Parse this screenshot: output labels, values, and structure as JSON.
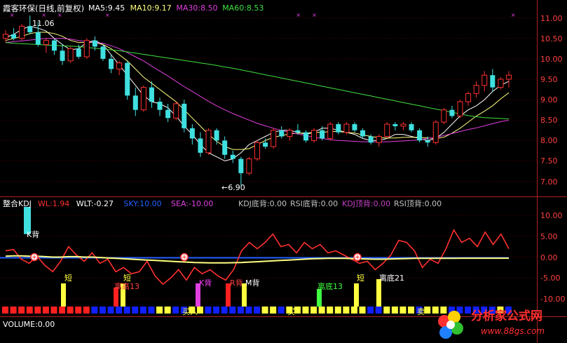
{
  "main": {
    "title": "霞客环保(日线,前复权)",
    "ma": [
      {
        "label": "MA5:9.45",
        "color": "#ffffff"
      },
      {
        "label": "MA10:9.17",
        "color": "#ffff80"
      },
      {
        "label": "MA30:8.50",
        "color": "#e040e0"
      },
      {
        "label": "MA60:8.53",
        "color": "#40e040"
      }
    ],
    "high_label": "11.06",
    "low_label": "←6.90",
    "y_ticks": [
      "11.00",
      "10.50",
      "10.00",
      "9.50",
      "9.00",
      "8.50",
      "8.00",
      "7.50",
      "7.00"
    ]
  },
  "kdj": {
    "title": "整合KDJ",
    "params": [
      {
        "label": "WL:1.94",
        "color": "#ff3030"
      },
      {
        "label": "WLT:-0.27",
        "color": "#ffffff"
      },
      {
        "label": "SKY:10.00",
        "color": "#2060ff"
      },
      {
        "label": "SEA:-10.00",
        "color": "#e040e0"
      },
      {
        "label": "KDJ底背:0.00",
        "color": "#c0c0c0"
      },
      {
        "label": "RSI底背:0.00",
        "color": "#c0c0c0"
      },
      {
        "label": "KDJ顶背:0.00",
        "color": "#c040c0"
      },
      {
        "label": "RSI顶背:0.00",
        "color": "#c0c0c0"
      }
    ],
    "y_ticks": [
      "10.00",
      "5.00",
      "0.00",
      "-5.00",
      "-10.00"
    ],
    "annotations": [
      {
        "text": "K背",
        "color": "#ffffff"
      },
      {
        "text": "短",
        "color": "#ffff40"
      },
      {
        "text": "离高13",
        "color": "#ff4040"
      },
      {
        "text": "短",
        "color": "#ffff40"
      },
      {
        "text": "K背",
        "color": "#ff40ff"
      },
      {
        "text": "R背",
        "color": "#ff4040"
      },
      {
        "text": "M背",
        "color": "#ffffff"
      },
      {
        "text": "离底13",
        "color": "#40ff40"
      },
      {
        "text": "短",
        "color": "#ffff40"
      },
      {
        "text": "离底21",
        "color": "#ffffff"
      },
      {
        "text": "买入",
        "color": "#ffff40"
      },
      {
        "text": "买",
        "color": "#ffff40"
      },
      {
        "text": "卖",
        "color": "#ffff40"
      }
    ]
  },
  "volume": {
    "label": "VOLUME:0.00"
  },
  "watermark": {
    "line1": "分析家公式网",
    "line2": "www.88gs.com"
  },
  "chart_data": [
    {
      "type": "candlestick",
      "title": "霞客环保(日线,前复权)",
      "ylim": [
        6.7,
        11.2
      ],
      "series": [
        {
          "name": "MA5",
          "values": [
            10.52,
            10.6,
            10.72,
            10.8,
            10.75,
            10.68,
            10.5,
            10.35,
            10.22,
            10.25,
            10.4,
            10.45,
            10.35,
            10.1,
            9.85,
            9.6,
            9.35,
            9.1,
            8.95,
            8.9,
            8.8,
            8.6,
            8.35,
            8.15,
            7.9,
            7.7,
            7.6,
            7.5,
            7.55,
            7.7,
            7.9,
            8.0,
            8.1,
            8.2,
            8.25,
            8.25,
            8.2,
            8.15,
            8.2,
            8.3,
            8.3,
            8.25,
            8.2,
            8.15,
            8.05,
            8.0,
            8.0,
            8.05,
            8.15,
            8.15,
            8.1,
            8.05,
            8.0,
            8.05,
            8.2,
            8.4,
            8.6,
            8.75,
            8.85,
            9.0,
            9.2,
            9.35,
            9.45
          ]
        },
        {
          "name": "MA10",
          "values": [
            10.45,
            10.5,
            10.55,
            10.62,
            10.65,
            10.65,
            10.62,
            10.55,
            10.45,
            10.4,
            10.4,
            10.4,
            10.35,
            10.25,
            10.1,
            9.95,
            9.75,
            9.55,
            9.4,
            9.25,
            9.1,
            8.95,
            8.75,
            8.55,
            8.35,
            8.15,
            7.98,
            7.85,
            7.78,
            7.78,
            7.8,
            7.9,
            8.0,
            8.08,
            8.12,
            8.16,
            8.18,
            8.18,
            8.2,
            8.2,
            8.22,
            8.22,
            8.2,
            8.18,
            8.14,
            8.1,
            8.07,
            8.06,
            8.06,
            8.08,
            8.08,
            8.08,
            8.06,
            8.05,
            8.08,
            8.18,
            8.3,
            8.45,
            8.6,
            8.72,
            8.85,
            9.02,
            9.17
          ]
        },
        {
          "name": "MA30",
          "values": [
            10.4,
            10.42,
            10.44,
            10.46,
            10.48,
            10.5,
            10.5,
            10.5,
            10.48,
            10.45,
            10.42,
            10.4,
            10.38,
            10.32,
            10.25,
            10.15,
            10.05,
            9.95,
            9.82,
            9.7,
            9.58,
            9.45,
            9.32,
            9.2,
            9.08,
            8.96,
            8.85,
            8.75,
            8.66,
            8.58,
            8.5,
            8.42,
            8.36,
            8.3,
            8.25,
            8.2,
            8.16,
            8.12,
            8.08,
            8.05,
            8.02,
            8.0,
            7.99,
            7.98,
            7.97,
            7.97,
            7.97,
            7.97,
            7.98,
            7.99,
            8.0,
            8.02,
            8.05,
            8.08,
            8.12,
            8.17,
            8.22,
            8.27,
            8.31,
            8.36,
            8.41,
            8.46,
            8.5
          ]
        },
        {
          "name": "MA60",
          "values": [
            10.4,
            10.38,
            10.37,
            10.36,
            10.35,
            10.34,
            10.33,
            10.32,
            10.31,
            10.3,
            10.28,
            10.26,
            10.24,
            10.22,
            10.2,
            10.17,
            10.14,
            10.11,
            10.08,
            10.05,
            10.02,
            9.99,
            9.96,
            9.93,
            9.9,
            9.87,
            9.84,
            9.8,
            9.77,
            9.73,
            9.69,
            9.65,
            9.61,
            9.57,
            9.53,
            9.49,
            9.45,
            9.41,
            9.37,
            9.33,
            9.29,
            9.25,
            9.21,
            9.17,
            9.13,
            9.09,
            9.05,
            9.01,
            8.97,
            8.93,
            8.89,
            8.85,
            8.81,
            8.77,
            8.73,
            8.69,
            8.65,
            8.61,
            8.58,
            8.56,
            8.55,
            8.54,
            8.53
          ]
        }
      ],
      "candles": [
        [
          10.5,
          10.7,
          10.4,
          10.6
        ],
        [
          10.6,
          10.75,
          10.45,
          10.5
        ],
        [
          10.5,
          10.85,
          10.45,
          10.8
        ],
        [
          10.8,
          11.06,
          10.6,
          10.65
        ],
        [
          10.65,
          10.9,
          10.3,
          10.35
        ],
        [
          10.35,
          10.5,
          10.15,
          10.45
        ],
        [
          10.45,
          10.5,
          10.1,
          10.2
        ],
        [
          10.2,
          10.35,
          9.85,
          9.95
        ],
        [
          9.95,
          10.3,
          9.9,
          10.25
        ],
        [
          10.25,
          10.35,
          10.0,
          10.05
        ],
        [
          10.05,
          10.5,
          10.0,
          10.45
        ],
        [
          10.45,
          10.55,
          10.2,
          10.3
        ],
        [
          10.3,
          10.35,
          9.95,
          10.0
        ],
        [
          10.0,
          10.1,
          9.65,
          9.75
        ],
        [
          9.75,
          9.95,
          9.6,
          9.9
        ],
        [
          9.9,
          9.95,
          9.0,
          9.1
        ],
        [
          9.1,
          9.3,
          8.6,
          8.75
        ],
        [
          8.75,
          9.35,
          8.7,
          9.3
        ],
        [
          9.3,
          9.45,
          8.8,
          8.95
        ],
        [
          8.95,
          9.05,
          8.6,
          8.75
        ],
        [
          8.75,
          8.9,
          8.45,
          8.55
        ],
        [
          8.55,
          8.95,
          8.5,
          8.9
        ],
        [
          8.9,
          9.0,
          8.2,
          8.3
        ],
        [
          8.3,
          8.4,
          7.9,
          8.05
        ],
        [
          8.05,
          8.2,
          7.6,
          7.7
        ],
        [
          7.7,
          8.3,
          7.65,
          8.25
        ],
        [
          8.25,
          8.3,
          7.9,
          8.0
        ],
        [
          8.0,
          8.1,
          7.55,
          7.65
        ],
        [
          7.65,
          7.75,
          7.45,
          7.55
        ],
        [
          7.55,
          7.6,
          6.9,
          7.2
        ],
        [
          7.2,
          7.6,
          7.15,
          7.55
        ],
        [
          7.55,
          8.0,
          7.5,
          7.95
        ],
        [
          7.95,
          8.05,
          7.8,
          7.85
        ],
        [
          7.85,
          8.3,
          7.8,
          8.25
        ],
        [
          8.25,
          8.35,
          8.05,
          8.1
        ],
        [
          8.1,
          8.3,
          8.0,
          8.25
        ],
        [
          8.25,
          8.4,
          8.15,
          8.2
        ],
        [
          8.2,
          8.25,
          7.95,
          8.0
        ],
        [
          8.0,
          8.3,
          7.95,
          8.25
        ],
        [
          8.25,
          8.35,
          8.0,
          8.05
        ],
        [
          8.05,
          8.45,
          8.0,
          8.4
        ],
        [
          8.4,
          8.45,
          8.15,
          8.2
        ],
        [
          8.2,
          8.45,
          8.15,
          8.4
        ],
        [
          8.4,
          8.45,
          8.2,
          8.25
        ],
        [
          8.25,
          8.3,
          8.05,
          8.1
        ],
        [
          8.1,
          8.15,
          7.9,
          7.95
        ],
        [
          7.95,
          8.15,
          7.85,
          8.1
        ],
        [
          8.1,
          8.45,
          8.05,
          8.4
        ],
        [
          8.4,
          8.45,
          8.25,
          8.35
        ],
        [
          8.35,
          8.45,
          8.25,
          8.4
        ],
        [
          8.4,
          8.45,
          8.2,
          8.25
        ],
        [
          8.25,
          8.3,
          7.95,
          8.0
        ],
        [
          8.0,
          8.1,
          7.85,
          7.95
        ],
        [
          7.95,
          8.5,
          7.9,
          8.45
        ],
        [
          8.45,
          8.8,
          8.4,
          8.75
        ],
        [
          8.75,
          8.85,
          8.55,
          8.6
        ],
        [
          8.6,
          9.0,
          8.55,
          8.95
        ],
        [
          8.95,
          9.2,
          8.85,
          9.15
        ],
        [
          9.15,
          9.45,
          9.05,
          9.35
        ],
        [
          9.35,
          9.7,
          9.2,
          9.6
        ],
        [
          9.6,
          9.75,
          9.2,
          9.3
        ],
        [
          9.3,
          9.55,
          9.25,
          9.5
        ],
        [
          9.5,
          9.7,
          9.3,
          9.6
        ]
      ]
    },
    {
      "type": "line",
      "title": "整合KDJ",
      "ylim": [
        -12,
        12
      ],
      "series": [
        {
          "name": "WL",
          "values": [
            1.5,
            1.8,
            -0.5,
            -1.5,
            0.2,
            -2.0,
            -3.5,
            -1.0,
            2.5,
            0.5,
            -1.0,
            1.0,
            -1.5,
            -0.5,
            -3.5,
            -2.5,
            -4.0,
            -3.5,
            -1.0,
            -4.5,
            -6.5,
            -5.0,
            -3.0,
            -5.5,
            -2.5,
            -4.0,
            -3.0,
            -4.5,
            -5.5,
            -3.0,
            1.5,
            3.5,
            2.0,
            3.5,
            5.5,
            2.5,
            3.0,
            1.0,
            3.5,
            2.0,
            3.0,
            1.0,
            1.5,
            0.5,
            -0.5,
            -1.5,
            -1.0,
            -3.0,
            -1.5,
            0.5,
            4.0,
            3.5,
            1.5,
            -2.5,
            -0.5,
            -1.5,
            2.0,
            6.5,
            3.5,
            4.5,
            2.5,
            6.0,
            3.0,
            5.5,
            2.0
          ]
        },
        {
          "name": "WLT",
          "values": [
            0.2,
            0.3,
            0.3,
            0.2,
            0.2,
            0.1,
            0.0,
            0.0,
            0.1,
            0.1,
            0.0,
            0.0,
            -0.1,
            -0.2,
            -0.3,
            -0.4,
            -0.5,
            -0.6,
            -0.7,
            -0.8,
            -0.9,
            -1.0,
            -1.1,
            -1.2,
            -1.3,
            -1.35,
            -1.4,
            -1.4,
            -1.4,
            -1.35,
            -1.3,
            -1.2,
            -1.1,
            -1.0,
            -0.9,
            -0.8,
            -0.7,
            -0.6,
            -0.5,
            -0.4,
            -0.35,
            -0.3,
            -0.3,
            -0.3,
            -0.35,
            -0.4,
            -0.45,
            -0.5,
            -0.5,
            -0.45,
            -0.4,
            -0.35,
            -0.3,
            -0.3,
            -0.3,
            -0.3,
            -0.3,
            -0.28,
            -0.27,
            -0.27,
            -0.27,
            -0.27,
            -0.27,
            -0.27,
            -0.27
          ]
        }
      ]
    }
  ]
}
